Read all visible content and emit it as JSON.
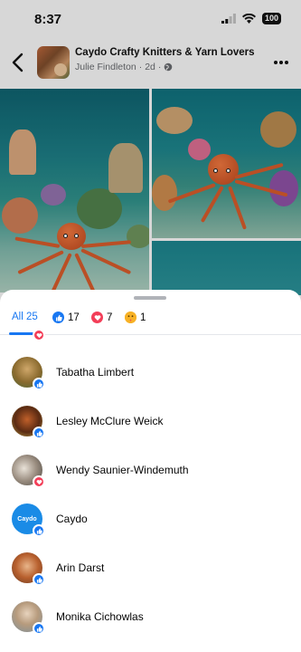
{
  "status_bar": {
    "time": "8:37",
    "battery": "100"
  },
  "post_header": {
    "group_name": "Caydo Crafty Knitters & Yarn Lovers",
    "author": "Julie Findleton",
    "time_ago": "2d"
  },
  "reactions_sheet": {
    "tabs": [
      {
        "label": "All 25",
        "type": "all"
      },
      {
        "count": "17",
        "type": "like"
      },
      {
        "count": "7",
        "type": "love"
      },
      {
        "count": "1",
        "type": "care"
      }
    ],
    "people": [
      {
        "name": "Tabatha Limbert",
        "reaction": "like"
      },
      {
        "name": "Lesley McClure Weick",
        "reaction": "like"
      },
      {
        "name": "Wendy Saunier-Windemuth",
        "reaction": "love"
      },
      {
        "name": "Caydo",
        "reaction": "like",
        "avatar_text": "Caydo"
      },
      {
        "name": "Arin Darst",
        "reaction": "like"
      },
      {
        "name": "Monika Cichowlas",
        "reaction": "like"
      }
    ]
  },
  "colors": {
    "accent": "#1877f2",
    "love": "#f33e58",
    "care": "#f7b125"
  }
}
